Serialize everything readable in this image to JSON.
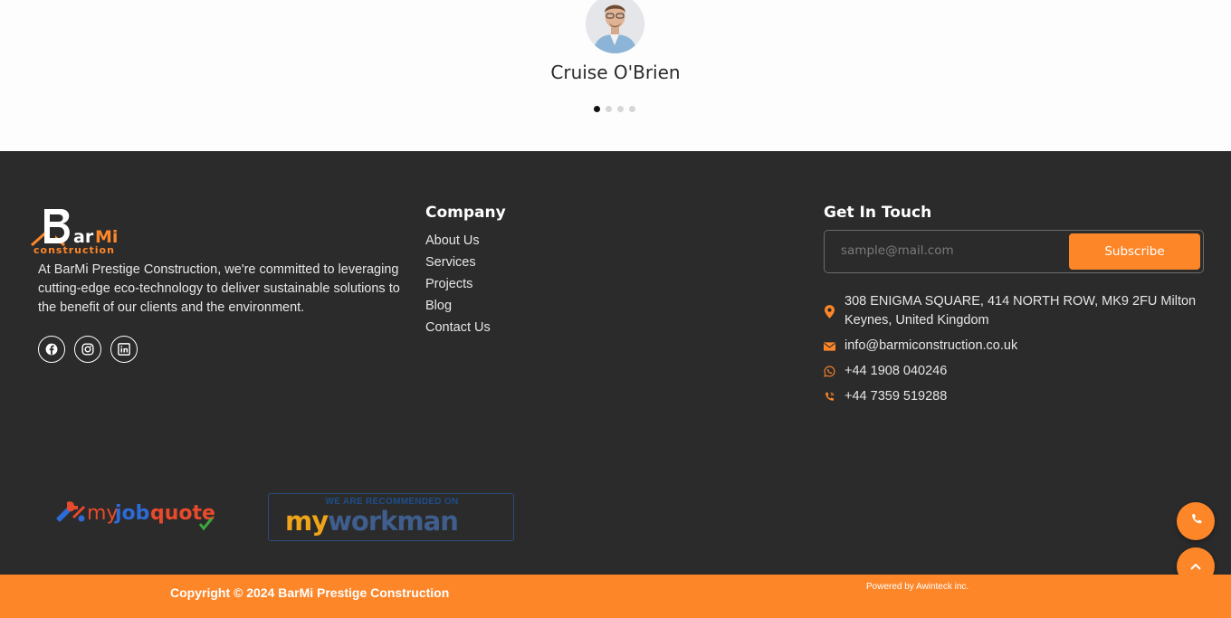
{
  "testimonial": {
    "name": "Cruise O'Brien",
    "dots": 4,
    "active_dot": 0
  },
  "footer": {
    "about_text": "At BarMi Prestige Construction, we're committed to leveraging cutting-edge eco-technology to deliver sustainable solutions to the benefit of our clients and the environment.",
    "logo": {
      "text_main": "arMi",
      "text_sub": "construction",
      "brand_color": "#fd8629"
    },
    "socials": [
      "facebook-icon",
      "instagram-icon",
      "linkedin-icon"
    ],
    "company": {
      "title": "Company",
      "links": [
        "About Us",
        "Services",
        "Projects",
        "Blog",
        "Contact Us"
      ]
    },
    "touch": {
      "title": "Get In Touch",
      "email_placeholder": "sample@mail.com",
      "subscribe_label": "Subscribe",
      "address": "308 ENIGMA SQUARE, 414 NORTH ROW, MK9 2FU Milton Keynes, United Kingdom",
      "email": "info@barmiconstruction.co.uk",
      "whatsapp": "+44 1908 040246",
      "phone": "+44 7359 519288"
    },
    "badges": {
      "myjobquote": {
        "my": "my",
        "job": "job",
        "quote": "quote"
      },
      "myworkman": {
        "recommended": "WE ARE RECOMMENDED ON",
        "my": "my",
        "workman": "workman"
      }
    }
  },
  "bottom_bar": {
    "copyright": "Copyright © 2024 BarMi Prestige Construction",
    "powered": "Powered by Awinteck inc."
  },
  "colors": {
    "accent": "#fd8629",
    "footer_bg": "#2b2b2b"
  }
}
